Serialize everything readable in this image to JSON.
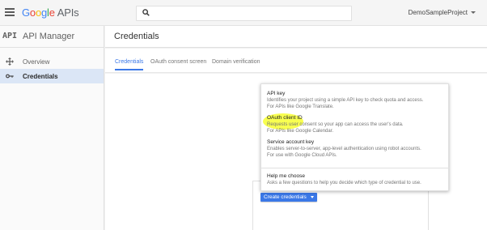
{
  "topbar": {
    "logo_letters": [
      "G",
      "o",
      "o",
      "g",
      "l",
      "e"
    ],
    "logo_suffix": "APIs",
    "search_placeholder": "",
    "project_name": "DemoSampleProject"
  },
  "sidebar": {
    "api_badge": "API",
    "title": "API Manager",
    "items": [
      {
        "label": "Overview",
        "icon": "move-arrows-icon",
        "active": false
      },
      {
        "label": "Credentials",
        "icon": "key-icon",
        "active": true
      }
    ]
  },
  "main": {
    "title": "Credentials",
    "tabs": [
      {
        "label": "Credentials",
        "active": true
      },
      {
        "label": "OAuth consent screen",
        "active": false
      },
      {
        "label": "Domain verification",
        "active": false
      }
    ],
    "create_button": "Create credentials"
  },
  "menu": {
    "items": [
      {
        "title": "API key",
        "desc1": "Identifies your project using a simple API key to check quota and access.",
        "desc2": "For APIs like Google Translate."
      },
      {
        "title": "OAuth client ID",
        "desc1": "Requests user consent so your app can access the user's data.",
        "desc2": "For APIs like Google Calendar."
      },
      {
        "title": "Service account key",
        "desc1": "Enables server-to-server, app-level authentication using robot accounts.",
        "desc2": "For use with Google Cloud APIs."
      },
      {
        "title": "Help me choose",
        "desc1": "Asks a few questions to help you decide which type of credential to use.",
        "desc2": ""
      }
    ],
    "highlight_color": "#f8ff47"
  },
  "colors": {
    "accent": "#3b78e7",
    "sidebar_active": "#dbe6f6"
  }
}
